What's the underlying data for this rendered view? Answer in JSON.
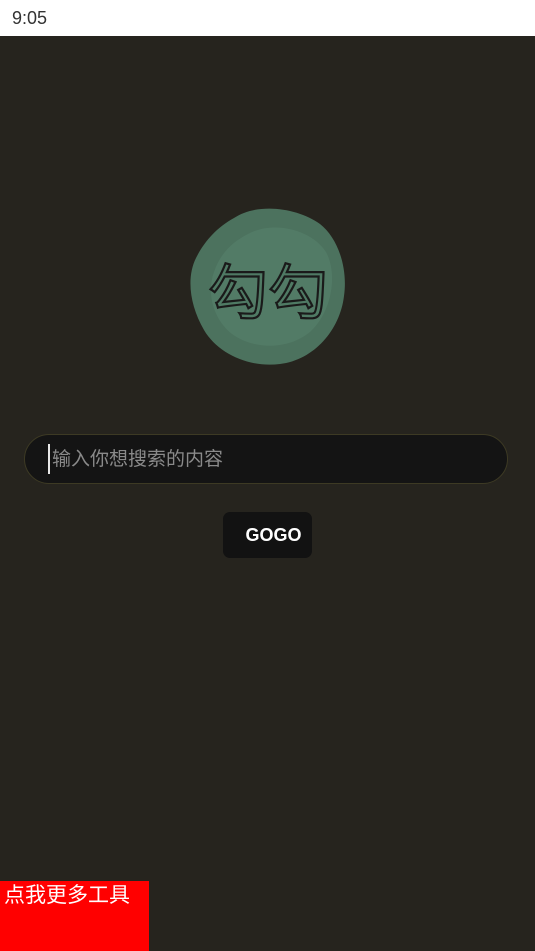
{
  "status_bar": {
    "time": "9:05"
  },
  "logo": {
    "text": "勾勾",
    "blob_color": "#4f7a64"
  },
  "search": {
    "placeholder": "输入你想搜索的内容",
    "value": ""
  },
  "go_button": {
    "label": "GOGO"
  },
  "more_tools": {
    "label": "点我更多工具",
    "color": "#ff0000"
  },
  "colors": {
    "background": "#26241e",
    "input_background": "#141414"
  }
}
